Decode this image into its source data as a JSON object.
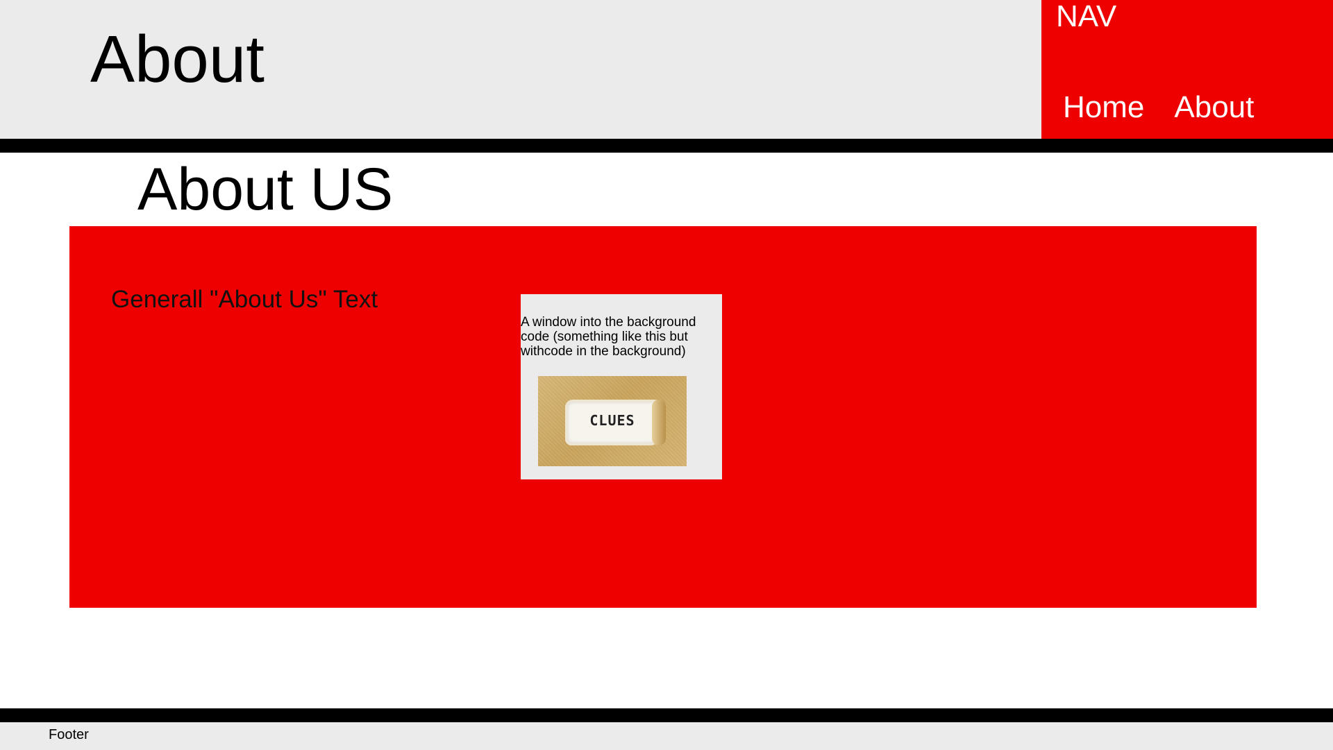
{
  "header": {
    "title": "About"
  },
  "nav": {
    "heading": "NAV",
    "links": [
      {
        "label": "Home"
      },
      {
        "label": "About"
      }
    ]
  },
  "main": {
    "title": "About US",
    "general_text": "Generall \"About Us\" Text",
    "window": {
      "description": "A window into the background code (something like this but withcode in the background)",
      "image_text": "CLUES"
    }
  },
  "footer": {
    "text": "Footer"
  },
  "colors": {
    "accent": "#ee0000",
    "panel": "#ebebeb",
    "rule": "#000000"
  }
}
